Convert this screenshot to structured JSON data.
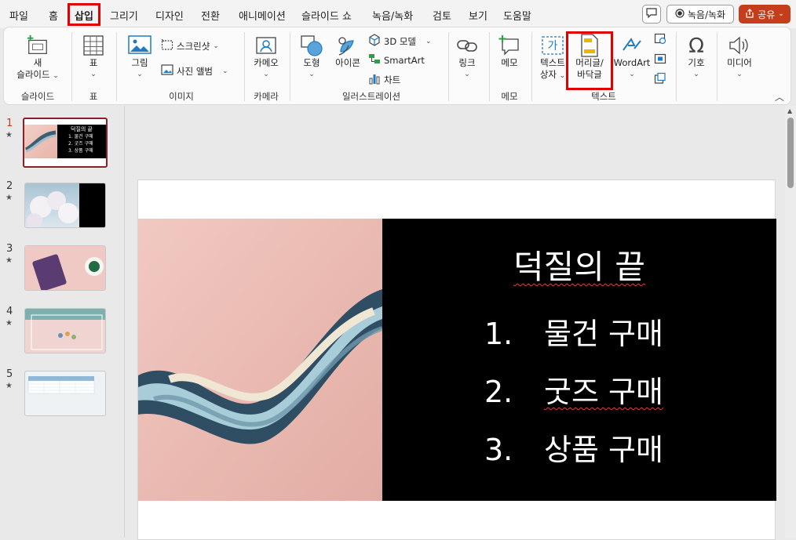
{
  "menu": {
    "tabs": [
      "파일",
      "홈",
      "삽입",
      "그리기",
      "디자인",
      "전환",
      "애니메이션",
      "슬라이드 쇼",
      "녹음/녹화",
      "검토",
      "보기",
      "도움말"
    ],
    "active": "삽입",
    "comment_icon": "comment-icon",
    "record_label": "녹음/녹화",
    "share_label": "공유"
  },
  "ribbon": {
    "new_slide": [
      "새",
      "슬라이드"
    ],
    "table": "표",
    "picture": "그림",
    "screenshot": "스크린샷",
    "photo_album": "사진 앨범",
    "cameo": "카메오",
    "shapes": "도형",
    "icons": "아이콘",
    "model3d": "3D 모델",
    "smartart": "SmartArt",
    "chart": "차트",
    "link": "링크",
    "comment": "메모",
    "textbox": [
      "텍스트",
      "상자"
    ],
    "header_footer": [
      "머리글/",
      "바닥글"
    ],
    "wordart": "WordArt",
    "symbols": "기호",
    "media": "미디어",
    "groups": {
      "slides": "슬라이드",
      "tables": "표",
      "images": "이미지",
      "camera": "카메라",
      "illustrations": "일러스트레이션",
      "comments": "메모",
      "text": "텍스트"
    }
  },
  "thumbnails": [
    {
      "num": "1",
      "title": "덕질의 끝",
      "items": [
        "1.  물건 구매",
        "2.  굿즈 구매",
        "3.  상품 구매"
      ]
    },
    {
      "num": "2"
    },
    {
      "num": "3"
    },
    {
      "num": "4"
    },
    {
      "num": "5"
    }
  ],
  "slide": {
    "title": "덕질의 끝",
    "items": [
      {
        "num": "1.",
        "text": "물건 구매"
      },
      {
        "num": "2.",
        "text": "굿즈 구매"
      },
      {
        "num": "3.",
        "text": "상품 구매"
      }
    ]
  },
  "colors": {
    "accent": "#c43e1c",
    "highlight": "#e00000",
    "selected_thumb": "#8f1d26"
  }
}
